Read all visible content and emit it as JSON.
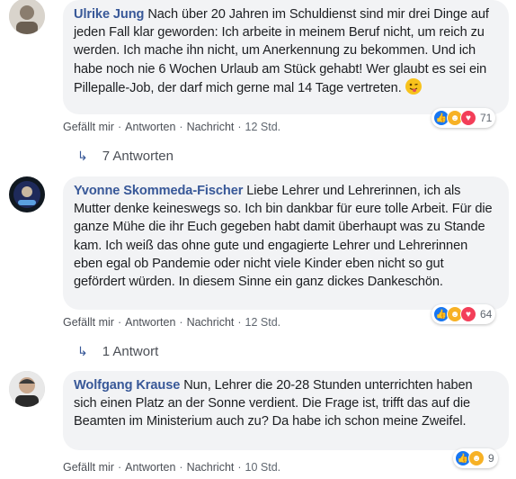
{
  "comments": [
    {
      "author": "Ulrike Jung",
      "text": "Nach über 20 Jahren im Schuldienst sind mir drei Dinge auf jeden Fall klar geworden: Ich arbeite in meinem Beruf nicht, um reich zu werden. Ich mache ihn nicht, um Anerkennung zu bekommen. Und ich habe noch nie 6 Wochen Urlaub am Stück gehabt! Wer glaubt es sei ein Pillepalle-Job, der darf mich gerne mal 14 Tage vertreten.",
      "emoji": "winking-tongue-emoji",
      "like": "Gefällt mir",
      "reply": "Antworten",
      "message": "Nachricht",
      "time": "12 Std.",
      "reactions_count": "71",
      "replies_label": "7 Antworten"
    },
    {
      "author": "Yvonne Skommeda-Fischer",
      "text": "Liebe Lehrer und Lehrerinnen, ich als Mutter denke keineswegs so. Ich bin dankbar für eure tolle Arbeit. Für die ganze Mühe die ihr Euch gegeben habt damit überhaupt was zu Stande kam. Ich weiß das ohne gute und engagierte Lehrer und Lehrerinnen eben egal ob Pandemie oder nicht viele Kinder eben nicht so gut gefördert würden. In diesem Sinne ein ganz dickes Dankeschön.",
      "like": "Gefällt mir",
      "reply": "Antworten",
      "message": "Nachricht",
      "time": "12 Std.",
      "reactions_count": "64",
      "replies_label": "1 Antwort"
    },
    {
      "author": "Wolfgang Krause",
      "text": "Nun, Lehrer die 20-28 Stunden unterrichten haben sich einen Platz an der Sonne verdient. Die Frage ist, trifft das auf die Beamten im Ministerium auch zu? Da habe ich schon meine Zweifel.",
      "like": "Gefällt mir",
      "reply": "Antworten",
      "message": "Nachricht",
      "time": "10 Std.",
      "reactions_count": "9"
    }
  ],
  "colors": {
    "author": "#385898",
    "bubble": "#f2f3f5",
    "like": "#1877f2",
    "love": "#f33e58"
  }
}
